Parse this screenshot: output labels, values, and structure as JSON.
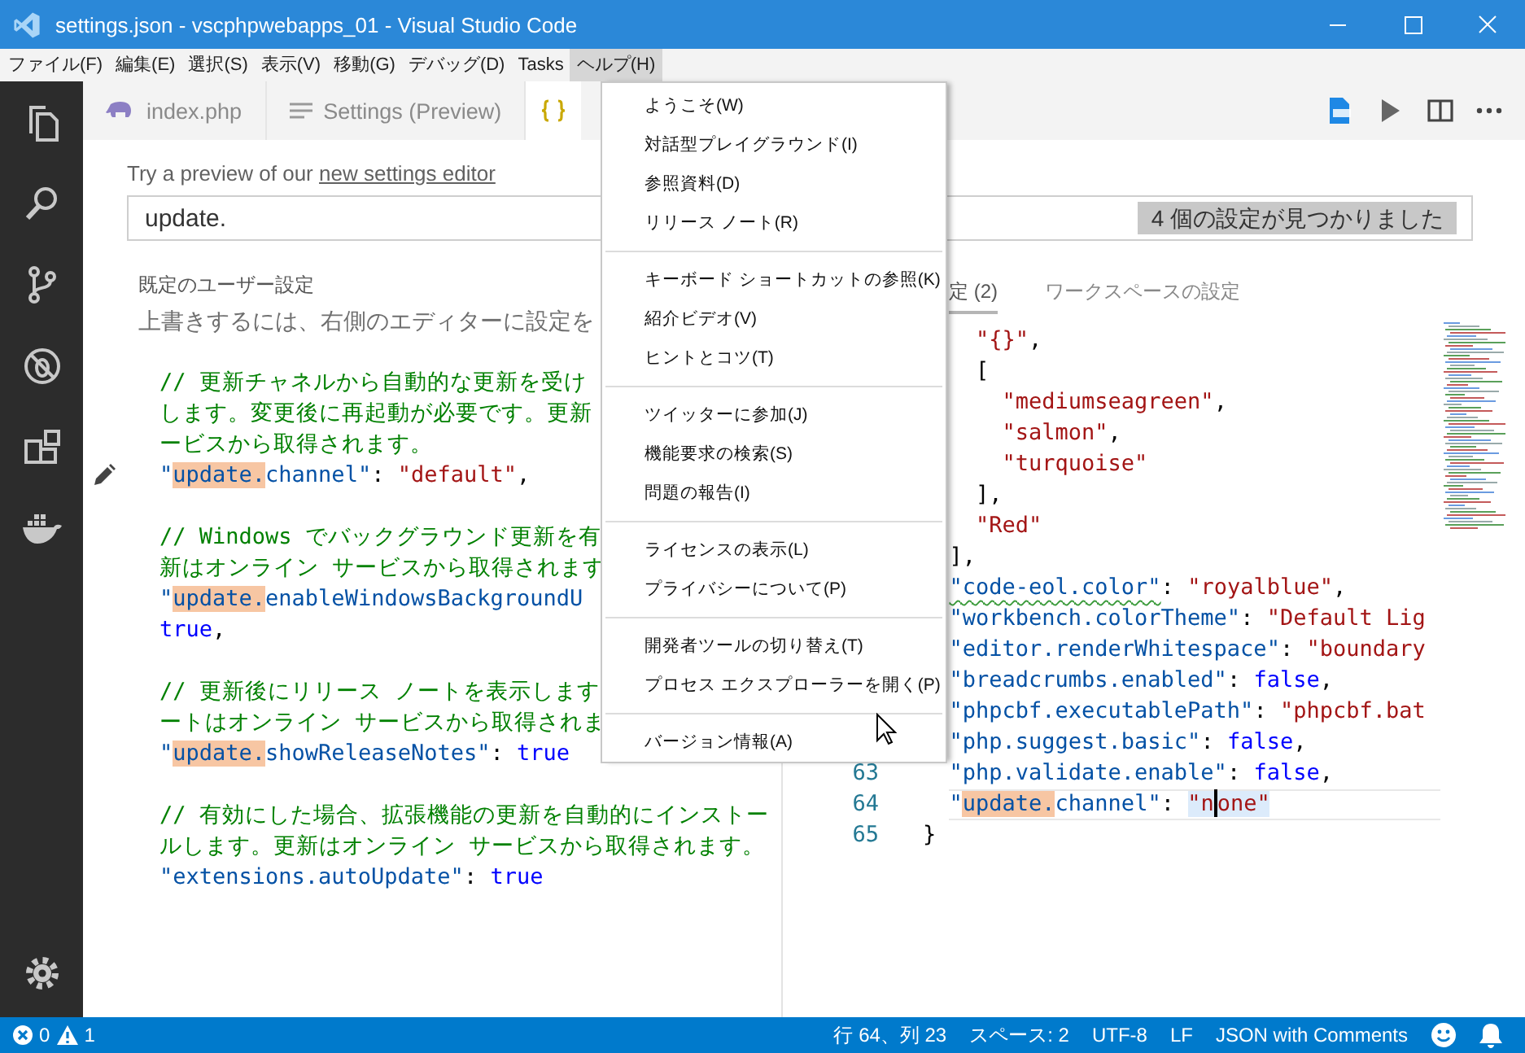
{
  "window": {
    "title": "settings.json - vscphpwebapps_01 - Visual Studio Code"
  },
  "menu_bar": [
    {
      "label": "ファイル(F)",
      "selected": false
    },
    {
      "label": "編集(E)",
      "selected": false
    },
    {
      "label": "選択(S)",
      "selected": false
    },
    {
      "label": "表示(V)",
      "selected": false
    },
    {
      "label": "移動(G)",
      "selected": false
    },
    {
      "label": "デバッグ(D)",
      "selected": false
    },
    {
      "label": "Tasks",
      "selected": false
    },
    {
      "label": "ヘルプ(H)",
      "selected": true
    }
  ],
  "tabs": [
    {
      "kind": "php",
      "label": "index.php",
      "selected": false
    },
    {
      "kind": "settings",
      "label": "Settings (Preview)",
      "selected": false
    },
    {
      "kind": "json",
      "selected": true
    }
  ],
  "settings": {
    "hint": "Try a preview of our",
    "hint_link": "new settings editor",
    "search": {
      "value": "update.",
      "result": "4 個の設定が見つかりました"
    }
  },
  "default_settings": {
    "title": "既定のユーザー設定",
    "description": "上書きするには、右側のエディターに設定を",
    "lines": [
      {
        "kind": "code",
        "pencil": false,
        "tokens": [
          {
            "kind": "comment",
            "text": "// 更新チャネルから自動的な更新を受け"
          }
        ]
      },
      {
        "kind": "code",
        "pencil": false,
        "tokens": [
          {
            "kind": "comment",
            "text": "します。変更後に再起動が必要です。更新"
          }
        ]
      },
      {
        "kind": "code",
        "pencil": false,
        "tokens": [
          {
            "kind": "comment",
            "text": "ービスから取得されます。"
          }
        ]
      },
      {
        "kind": "code",
        "pencil": true,
        "tokens": [
          {
            "kind": "key",
            "text": "\""
          },
          {
            "kind": "match",
            "text": "update."
          },
          {
            "kind": "key",
            "text": "channel\""
          },
          {
            "kind": "punct",
            "text": ": "
          },
          {
            "kind": "string",
            "text": "\"default\""
          },
          {
            "kind": "punct",
            "text": ","
          }
        ]
      },
      {
        "kind": "blank",
        "pencil": false
      },
      {
        "kind": "code",
        "pencil": false,
        "tokens": [
          {
            "kind": "comment",
            "text": "// Windows でバックグラウンド更新を有"
          }
        ]
      },
      {
        "kind": "code",
        "pencil": false,
        "tokens": [
          {
            "kind": "comment",
            "text": "新はオンライン サービスから取得されます"
          }
        ]
      },
      {
        "kind": "code",
        "pencil": false,
        "tokens": [
          {
            "kind": "key",
            "text": "\""
          },
          {
            "kind": "match",
            "text": "update."
          },
          {
            "kind": "key",
            "text": "enableWindowsBackgroundU"
          }
        ]
      },
      {
        "kind": "code",
        "pencil": false,
        "tokens": [
          {
            "kind": "bool",
            "text": "true"
          },
          {
            "kind": "punct",
            "text": ","
          }
        ]
      },
      {
        "kind": "blank",
        "pencil": false
      },
      {
        "kind": "code",
        "pencil": false,
        "tokens": [
          {
            "kind": "comment",
            "text": "// 更新後にリリース ノートを表示します"
          }
        ]
      },
      {
        "kind": "code",
        "pencil": false,
        "tokens": [
          {
            "kind": "comment",
            "text": "ートはオンライン サービスから取得されま"
          }
        ]
      },
      {
        "kind": "code",
        "pencil": false,
        "tokens": [
          {
            "kind": "key",
            "text": "\""
          },
          {
            "kind": "match",
            "text": "update."
          },
          {
            "kind": "key",
            "text": "showReleaseNotes\""
          },
          {
            "kind": "punct",
            "text": ": "
          },
          {
            "kind": "bool",
            "text": "true"
          }
        ]
      },
      {
        "kind": "blank",
        "pencil": false
      },
      {
        "kind": "code",
        "pencil": false,
        "tokens": [
          {
            "kind": "comment",
            "text": "// 有効にした場合、拡張機能の更新を自動的にインストー"
          }
        ]
      },
      {
        "kind": "code",
        "pencil": false,
        "tokens": [
          {
            "kind": "comment",
            "text": "ルします。更新はオンライン サービスから取得されます。"
          }
        ]
      },
      {
        "kind": "code",
        "pencil": false,
        "tokens": [
          {
            "kind": "key",
            "text": "\"extensions.autoUpdate\""
          },
          {
            "kind": "punct",
            "text": ": "
          },
          {
            "kind": "bool",
            "text": "true"
          }
        ]
      }
    ]
  },
  "user_settings": {
    "tabs": [
      {
        "label": "定 (2)",
        "selected": true
      },
      {
        "label": "ワークスペースの設定",
        "selected": false
      }
    ],
    "lines": [
      {
        "current": false,
        "tokens": [
          {
            "kind": "string",
            "text": "\"{}\""
          },
          {
            "kind": "punct",
            "text": ","
          }
        ]
      },
      {
        "current": false,
        "tokens": [
          {
            "kind": "punct",
            "text": "["
          }
        ]
      },
      {
        "current": false,
        "tokens": [
          {
            "kind": "string",
            "text": "\"mediumseagreen\""
          },
          {
            "kind": "punct",
            "text": ","
          }
        ]
      },
      {
        "current": false,
        "tokens": [
          {
            "kind": "string",
            "text": "\"salmon\""
          },
          {
            "kind": "punct",
            "text": ","
          }
        ]
      },
      {
        "current": false,
        "tokens": [
          {
            "kind": "string",
            "text": "\"turquoise\""
          }
        ]
      },
      {
        "current": false,
        "tokens": [
          {
            "kind": "punct",
            "text": "],"
          }
        ]
      },
      {
        "current": false,
        "tokens": [
          {
            "kind": "string",
            "text": "\"Red\""
          }
        ]
      },
      {
        "current": false,
        "tokens": [
          {
            "kind": "punct",
            "text": "],"
          }
        ]
      },
      {
        "current": false,
        "tokens": [
          {
            "kind": "key_warn",
            "text": "\"code-eol.color\""
          },
          {
            "kind": "punct",
            "text": ": "
          },
          {
            "kind": "string",
            "text": "\"royalblue\""
          },
          {
            "kind": "punct",
            "text": ","
          }
        ]
      },
      {
        "current": false,
        "tokens": [
          {
            "kind": "key",
            "text": "\"workbench.colorTheme\""
          },
          {
            "kind": "punct",
            "text": ": "
          },
          {
            "kind": "string",
            "text": "\"Default Lig"
          }
        ]
      },
      {
        "current": false,
        "tokens": [
          {
            "kind": "key",
            "text": "\"editor.renderWhitespace\""
          },
          {
            "kind": "punct",
            "text": ": "
          },
          {
            "kind": "string",
            "text": "\"boundary"
          }
        ]
      },
      {
        "current": false,
        "tokens": [
          {
            "kind": "key",
            "text": "\"breadcrumbs.enabled\""
          },
          {
            "kind": "punct",
            "text": ": "
          },
          {
            "kind": "bool",
            "text": "false"
          },
          {
            "kind": "punct",
            "text": ","
          }
        ]
      },
      {
        "current": false,
        "tokens": [
          {
            "kind": "key",
            "text": "\"phpcbf.executablePath\""
          },
          {
            "kind": "punct",
            "text": ": "
          },
          {
            "kind": "string",
            "text": "\"phpcbf.bat"
          }
        ]
      },
      {
        "current": false,
        "tokens": [
          {
            "kind": "key",
            "text": "\"php.suggest.basic\""
          },
          {
            "kind": "punct",
            "text": ": "
          },
          {
            "kind": "bool",
            "text": "false"
          },
          {
            "kind": "punct",
            "text": ","
          }
        ]
      },
      {
        "number": "63",
        "current": false,
        "tokens": [
          {
            "kind": "key",
            "text": "\"php.validate.enable\""
          },
          {
            "kind": "punct",
            "text": ": "
          },
          {
            "kind": "bool",
            "text": "false"
          },
          {
            "kind": "punct",
            "text": ","
          }
        ]
      },
      {
        "number": "64",
        "current": true,
        "tokens": [
          {
            "kind": "key",
            "text": "\""
          },
          {
            "kind": "match",
            "text": "update."
          },
          {
            "kind": "key",
            "text": "channel\""
          },
          {
            "kind": "punct",
            "text": ": "
          },
          {
            "kind": "string_hl",
            "text": "\"n"
          },
          {
            "kind": "caret"
          },
          {
            "kind": "string_hl",
            "text": "one\""
          }
        ]
      },
      {
        "number": "65",
        "current": false,
        "tokens": [
          {
            "kind": "punct",
            "text": "}"
          }
        ]
      }
    ]
  },
  "help_menu": [
    [
      "ようこそ(W)",
      "対話型プレイグラウンド(I)",
      "参照資料(D)",
      "リリース ノート(R)"
    ],
    [
      "キーボード ショートカットの参照(K)",
      "紹介ビデオ(V)",
      "ヒントとコツ(T)"
    ],
    [
      "ツイッターに参加(J)",
      "機能要求の検索(S)",
      "問題の報告(I)"
    ],
    [
      "ライセンスの表示(L)",
      "プライバシーについて(P)"
    ],
    [
      "開発者ツールの切り替え(T)",
      "プロセス エクスプローラーを開く(P)"
    ],
    [
      "バージョン情報(A)"
    ]
  ],
  "status_bar": {
    "errors": "0",
    "warnings": "1",
    "items": [
      "行 64、列 23",
      "スペース: 2",
      "UTF-8",
      "LF",
      "JSON with Comments"
    ]
  }
}
